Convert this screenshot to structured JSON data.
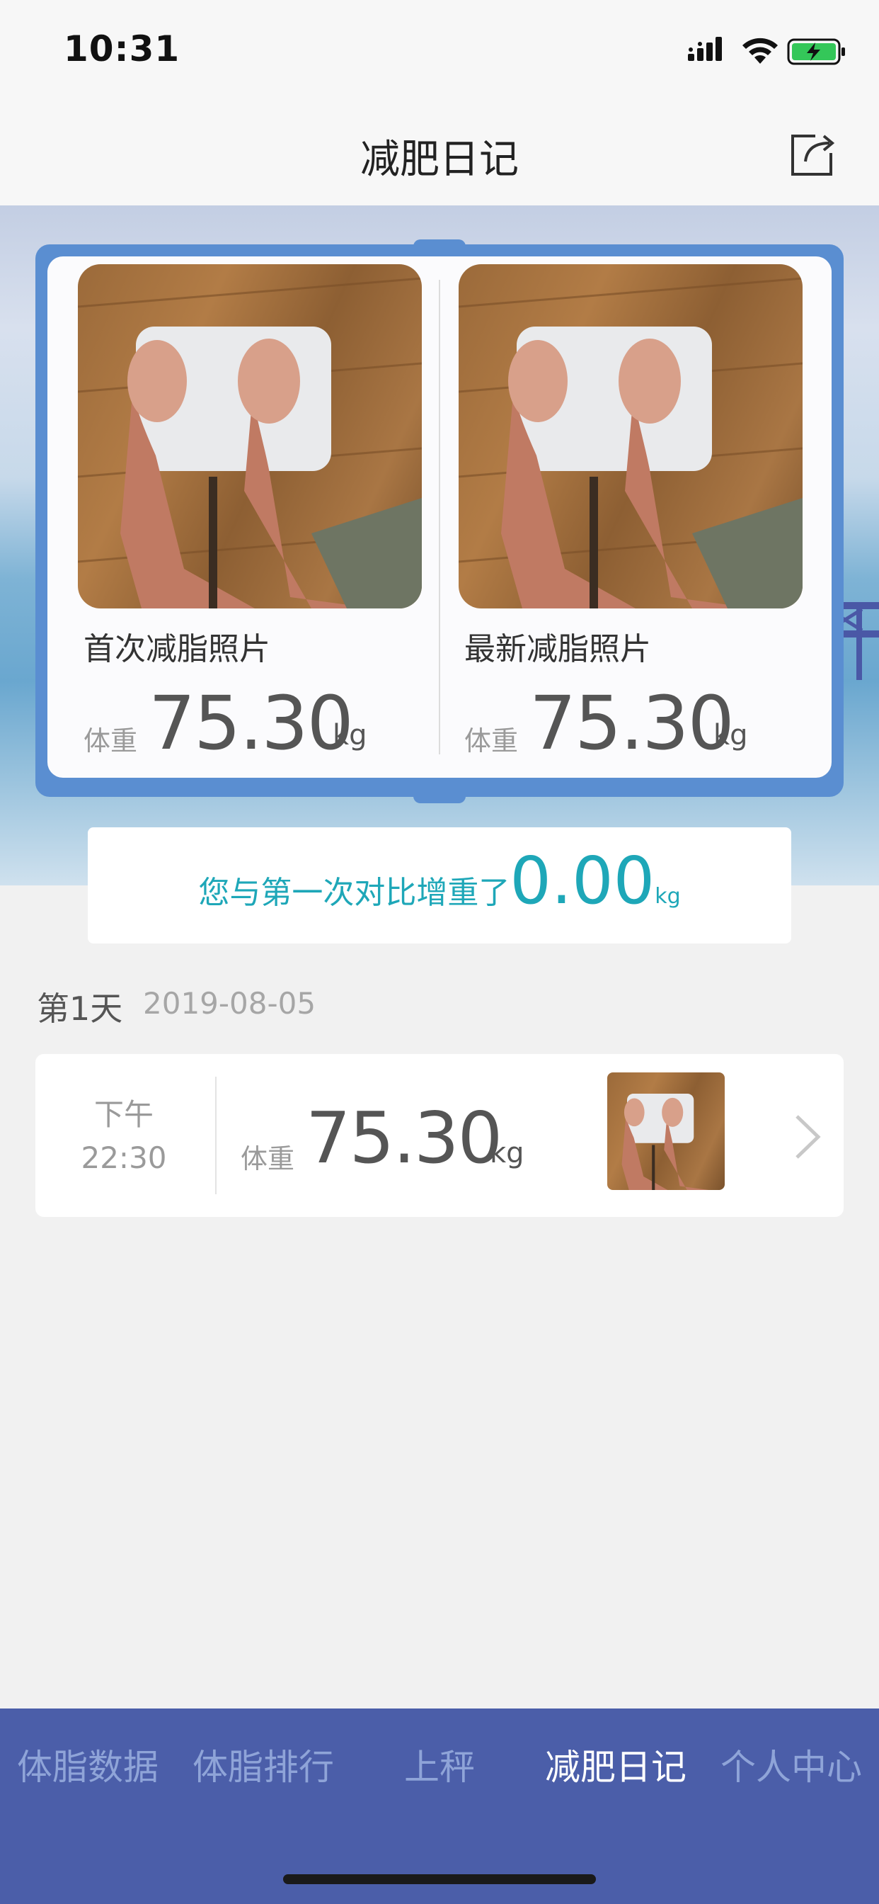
{
  "status_bar": {
    "time": "10:31",
    "icons": [
      "signal-icon",
      "wifi-icon",
      "battery-charging-icon"
    ]
  },
  "nav": {
    "title": "减肥日记",
    "share_icon": "share-icon"
  },
  "comparison_card": {
    "first": {
      "caption": "首次减脂照片",
      "weight_label": "体重",
      "weight_value": "75.30",
      "unit": "kg"
    },
    "latest": {
      "caption": "最新减脂照片",
      "weight_label": "体重",
      "weight_value": "75.30",
      "unit": "kg"
    }
  },
  "compare": {
    "text": "您与第一次对比增重了",
    "value": "0.00",
    "unit": "kg"
  },
  "day": {
    "label": "第1天",
    "date": "2019-08-05"
  },
  "records": [
    {
      "ampm": "下午",
      "time": "22:30",
      "weight_label": "体重",
      "weight_value": "75.30",
      "unit": "kg"
    }
  ],
  "tabs": [
    {
      "label": "体脂数据",
      "active": false
    },
    {
      "label": "体脂排行",
      "active": false
    },
    {
      "label": "上秤",
      "active": false
    },
    {
      "label": "减肥日记",
      "active": true
    },
    {
      "label": "个人中心",
      "active": false
    }
  ],
  "colors": {
    "accent": "#1ea7b8",
    "tab_bar": "#4b5ea9",
    "frame": "#5a8ed1"
  }
}
